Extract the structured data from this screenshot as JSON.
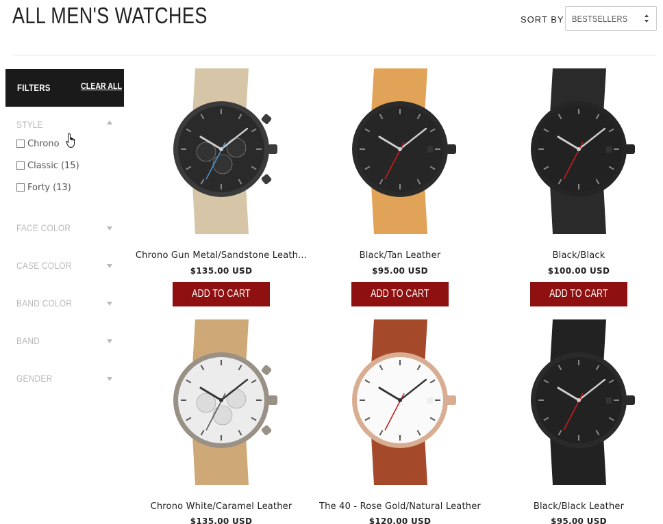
{
  "page": {
    "title": "ALL MEN'S WATCHES"
  },
  "sort": {
    "label": "SORT BY",
    "selected": "BESTSELLERS"
  },
  "sidebar": {
    "header": "FILTERS",
    "clear_all": "CLEAR ALL",
    "facets": [
      {
        "label": "STYLE",
        "expanded": true,
        "options": [
          {
            "label": "Chrono",
            "count": ""
          },
          {
            "label": "Classic",
            "count": "(15)"
          },
          {
            "label": "Forty",
            "count": "(13)"
          }
        ]
      },
      {
        "label": "FACE COLOR",
        "expanded": false
      },
      {
        "label": "CASE COLOR",
        "expanded": false
      },
      {
        "label": "BAND COLOR",
        "expanded": false
      },
      {
        "label": "BAND",
        "expanded": false
      },
      {
        "label": "GENDER",
        "expanded": false
      }
    ]
  },
  "products": [
    {
      "name": "Chrono Gun Metal/Sandstone Leath...",
      "price": "$135.00 USD",
      "cta": "ADD TO CART",
      "strap": "#d7c5a8",
      "case": "#3b3b3b",
      "dial": "#2a2a2a",
      "hand": "#4a90c8",
      "kind": "chrono"
    },
    {
      "name": "Black/Tan Leather",
      "price": "$95.00 USD",
      "cta": "ADD TO CART",
      "strap": "#e0a357",
      "case": "#2b2b2b",
      "dial": "#262626",
      "hand": "#c81d1d",
      "kind": "classic"
    },
    {
      "name": "Black/Black",
      "price": "$100.00 USD",
      "cta": "ADD TO CART",
      "strap": "#2a2a2a",
      "case": "#252525",
      "dial": "#222222",
      "hand": "#c81d1d",
      "kind": "classic"
    },
    {
      "name": "Chrono White/Caramel Leather",
      "price": "$135.00 USD",
      "cta": "",
      "strap": "#cfa877",
      "case": "#9a9186",
      "dial": "#ececec",
      "hand": "#555555",
      "kind": "chrono"
    },
    {
      "name": "The 40 - Rose Gold/Natural Leather",
      "price": "$120.00 USD",
      "cta": "",
      "strap": "#a44a2a",
      "case": "#d9ad92",
      "dial": "#fafafa",
      "hand": "#c81d1d",
      "kind": "classic-white"
    },
    {
      "name": "Black/Black Leather",
      "price": "$95.00 USD",
      "cta": "",
      "strap": "#222222",
      "case": "#2a2a2a",
      "dial": "#222222",
      "hand": "#c81d1d",
      "kind": "classic"
    }
  ],
  "colors": {
    "accent": "#8f1010",
    "sidebar_header_bg": "#1a1a1a",
    "facet_text": "#b9b9b9"
  },
  "icons": {
    "sort_arrows": "up-down-arrows-icon",
    "cursor": "hand-pointer-icon",
    "facet_caret": "caret-icon",
    "checkbox": "checkbox-icon"
  }
}
